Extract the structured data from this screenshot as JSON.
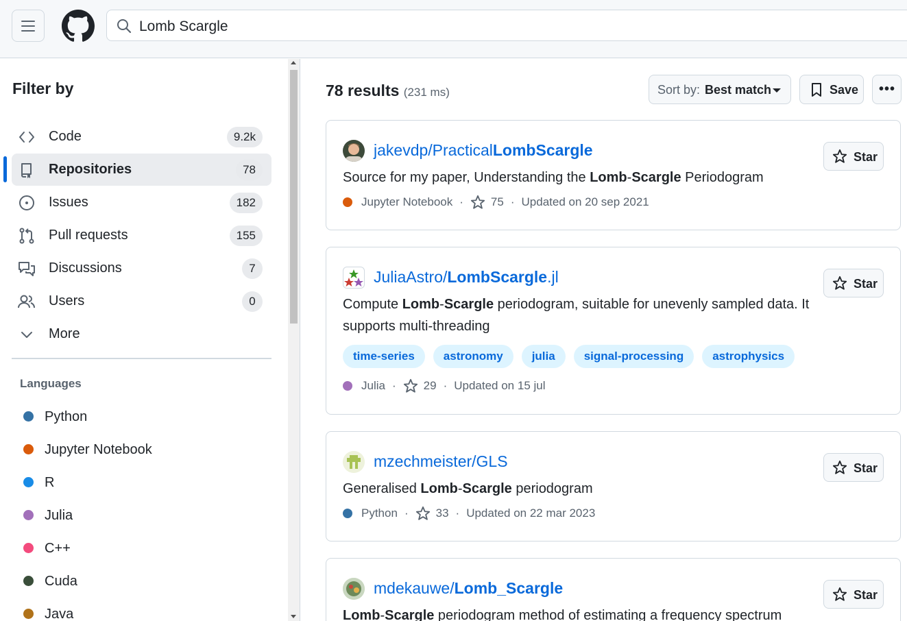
{
  "header": {
    "search_value": "Lomb Scargle"
  },
  "sidebar": {
    "title": "Filter by",
    "items": [
      {
        "icon": "code-icon",
        "label": "Code",
        "count": "9.2k"
      },
      {
        "icon": "repo-icon",
        "label": "Repositories",
        "count": "78"
      },
      {
        "icon": "issue-icon",
        "label": "Issues",
        "count": "182"
      },
      {
        "icon": "pull-request-icon",
        "label": "Pull requests",
        "count": "155"
      },
      {
        "icon": "discussion-icon",
        "label": "Discussions",
        "count": "7"
      },
      {
        "icon": "people-icon",
        "label": "Users",
        "count": "0"
      },
      {
        "icon": "chevron-down-icon",
        "label": "More"
      }
    ],
    "languages_heading": "Languages",
    "languages": [
      {
        "label": "Python",
        "color": "#3572a5"
      },
      {
        "label": "Jupyter Notebook",
        "color": "#da5b0b"
      },
      {
        "label": "R",
        "color": "#198ce7"
      },
      {
        "label": "Julia",
        "color": "#a270ba"
      },
      {
        "label": "C++",
        "color": "#f34b7d"
      },
      {
        "label": "Cuda",
        "color": "#3a4e3a"
      },
      {
        "label": "Java",
        "color": "#b07219"
      }
    ]
  },
  "results": {
    "count": "78 results",
    "time": "(231 ms)",
    "sort_label": "Sort by:",
    "sort_value": "Best match",
    "save_label": "Save",
    "star_label": "Star"
  },
  "repos": [
    {
      "owner": "jakevdp/",
      "name_pre": "Practical",
      "name_bold": "LombScargle",
      "name_post": "",
      "desc_parts": [
        "Source for my paper, Understanding the ",
        "Lomb",
        "-",
        "Scargle",
        " Periodogram"
      ],
      "language": "Jupyter Notebook",
      "language_color": "#da5b0b",
      "stars": "75",
      "updated": "Updated on 20 sep 2021"
    },
    {
      "owner": "JuliaAstro/",
      "name_pre": "",
      "name_bold": "LombScargle",
      "name_post": ".jl",
      "desc_parts": [
        "Compute ",
        "Lomb",
        "-",
        "Scargle",
        " periodogram, suitable for unevenly sampled data. It supports multi-threading"
      ],
      "topics": [
        "time-series",
        "astronomy",
        "julia",
        "signal-processing",
        "astrophysics"
      ],
      "language": "Julia",
      "language_color": "#a270ba",
      "stars": "29",
      "updated": "Updated on 15 jul"
    },
    {
      "owner": "mzechmeister/GLS",
      "name_pre": "",
      "name_bold": "",
      "name_post": "",
      "desc_parts": [
        "Generalised ",
        "Lomb",
        "-",
        "Scargle",
        " periodogram"
      ],
      "language": "Python",
      "language_color": "#3572a5",
      "stars": "33",
      "updated": "Updated on 22 mar 2023"
    },
    {
      "owner": "mdekauwe/",
      "name_pre": "",
      "name_bold": "Lomb_Scargle",
      "name_post": "",
      "desc_parts": [
        "",
        "Lomb",
        "-",
        "Scargle",
        " periodogram method of estimating a frequency spectrum"
      ]
    }
  ]
}
